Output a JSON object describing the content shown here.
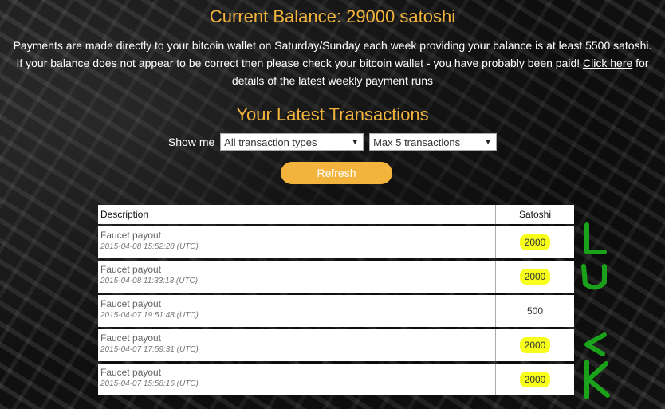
{
  "balance": {
    "label": "Current Balance: 29000 satoshi"
  },
  "info": {
    "line1": "Payments are made directly to your bitcoin wallet on Saturday/Sunday each week providing your balance is at least 5500 satoshi.",
    "line2_prefix": "If your balance does not appear to be correct then please check your bitcoin wallet - you have probably been paid! ",
    "link": "Click here",
    "line2_suffix": " for details of the latest weekly payment runs"
  },
  "transactions": {
    "title": "Your Latest Transactions",
    "show_me_label": "Show me",
    "type_select": "All transaction types",
    "count_select": "Max 5 transactions",
    "refresh_label": "Refresh",
    "columns": {
      "description": "Description",
      "satoshi": "Satoshi"
    },
    "rows": [
      {
        "description": "Faucet payout",
        "date": "2015-04-08 15:52:28 (UTC)",
        "satoshi": "2000",
        "highlighted": true
      },
      {
        "description": "Faucet payout",
        "date": "2015-04-08 11:33:13 (UTC)",
        "satoshi": "2000",
        "highlighted": true
      },
      {
        "description": "Faucet payout",
        "date": "2015-04-07 19:51:48 (UTC)",
        "satoshi": "500",
        "highlighted": false
      },
      {
        "description": "Faucet payout",
        "date": "2015-04-07 17:59:31 (UTC)",
        "satoshi": "2000",
        "highlighted": true
      },
      {
        "description": "Faucet payout",
        "date": "2015-04-07 15:58:16 (UTC)",
        "satoshi": "2000",
        "highlighted": true
      }
    ]
  },
  "annotation": {
    "text": "LUCK",
    "color": "#1aa31a"
  },
  "colors": {
    "accent": "#f2b43c",
    "highlight": "#f7ff1a"
  }
}
